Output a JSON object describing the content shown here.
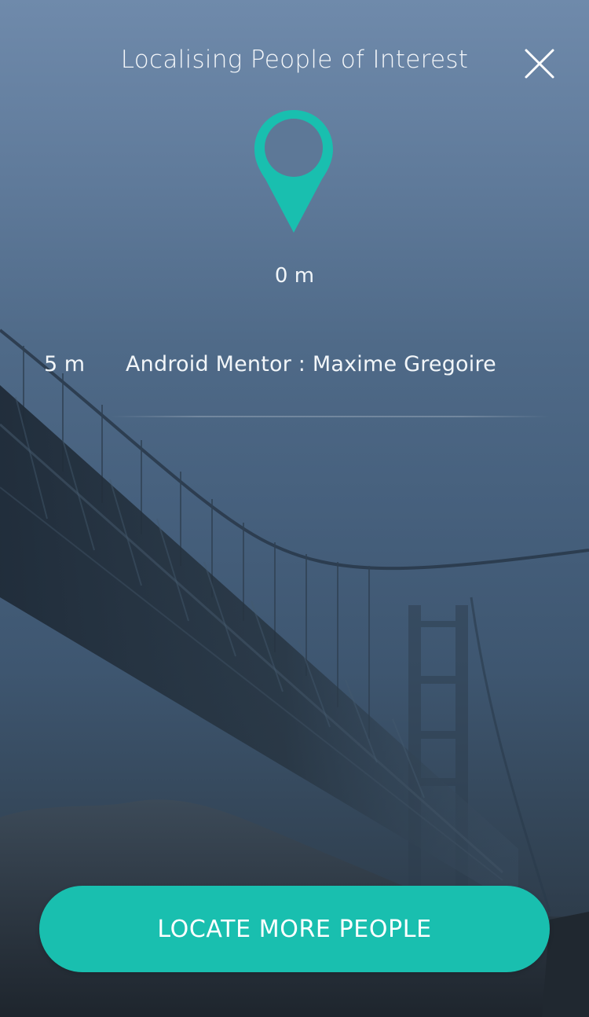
{
  "header": {
    "title": "Localising People of Interest",
    "close_icon": "close-icon"
  },
  "marker": {
    "icon": "map-pin-icon",
    "color": "#19bfaf",
    "distance_label": "0 m"
  },
  "people": [
    {
      "distance": "5 m",
      "name": "Android Mentor : Maxime Gregoire"
    }
  ],
  "actions": {
    "locate_label": "LOCATE MORE PEOPLE"
  },
  "colors": {
    "accent": "#19bfaf",
    "text": "#ffffff",
    "background_top": "#6f8aab",
    "background_bottom": "#28323d"
  }
}
